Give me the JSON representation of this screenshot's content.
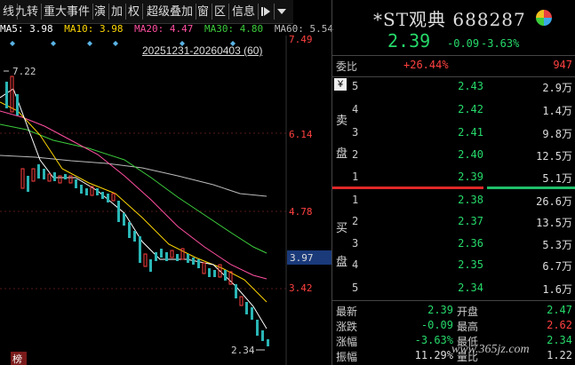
{
  "toolbar": {
    "items": [
      "线",
      "九转",
      "重大事件",
      "演",
      "加",
      "权",
      "超级叠加",
      "窗",
      "区",
      "信息"
    ],
    "pin_icon": "pin-icon",
    "more_icon": "chevron-down-icon"
  },
  "ma": {
    "ma5": "MA5: 3.98",
    "ma10": "MA10: 3.98",
    "ma20": "MA20: 4.47",
    "ma30": "MA30: 4.80",
    "ma60": "MA60: 5.54",
    "colors": {
      "ma5": "#ffffff",
      "ma10": "#ffd700",
      "ma20": "#ff4fa0",
      "ma30": "#3ccc3c",
      "ma60": "#bbbbbb"
    }
  },
  "chart": {
    "range_label": "20251231-20260403 (60)",
    "y_labels": [
      "7.49",
      "6.14",
      "4.78",
      "3.42"
    ],
    "current_label": "3.97",
    "high_label": "7.22",
    "low_label": "2.34",
    "bottom_tag": "榜"
  },
  "quote": {
    "title": "*ST观典 688287",
    "price": "2.39",
    "change": "-0.09",
    "change_pct": "-3.63%",
    "ratio_label": "委比",
    "ratio_value": "+26.44%",
    "ratio_diff": "947",
    "sell_label": [
      "卖",
      "盘"
    ],
    "buy_label": [
      "买",
      "盘"
    ],
    "currency_icon": "yen-icon",
    "sell": [
      {
        "level": "5",
        "price": "2.43",
        "vol": "2.9万"
      },
      {
        "level": "4",
        "price": "2.42",
        "vol": "1.4万"
      },
      {
        "level": "3",
        "price": "2.41",
        "vol": "9.8万"
      },
      {
        "level": "2",
        "price": "2.40",
        "vol": "12.5万"
      },
      {
        "level": "1",
        "price": "2.39",
        "vol": "5.1万"
      }
    ],
    "buy": [
      {
        "level": "1",
        "price": "2.38",
        "vol": "26.6万"
      },
      {
        "level": "2",
        "price": "2.37",
        "vol": "13.5万"
      },
      {
        "level": "3",
        "price": "2.36",
        "vol": "5.3万"
      },
      {
        "level": "4",
        "price": "2.35",
        "vol": "6.7万"
      },
      {
        "level": "5",
        "price": "2.34",
        "vol": "1.6万"
      }
    ],
    "stats": [
      {
        "l1": "最新",
        "v1": "2.39",
        "l2": "开盘",
        "v2": "2.47"
      },
      {
        "l1": "涨跌",
        "v1": "-0.09",
        "l2": "最高",
        "v2": "2.62"
      },
      {
        "l1": "涨幅",
        "v1": "-3.63%",
        "l2": "最低",
        "v2": "2.34"
      },
      {
        "l1": "振幅",
        "v1": "11.29%",
        "l2": "量比",
        "v2": "1.22"
      }
    ],
    "watermark": "www.365jz.com"
  }
}
